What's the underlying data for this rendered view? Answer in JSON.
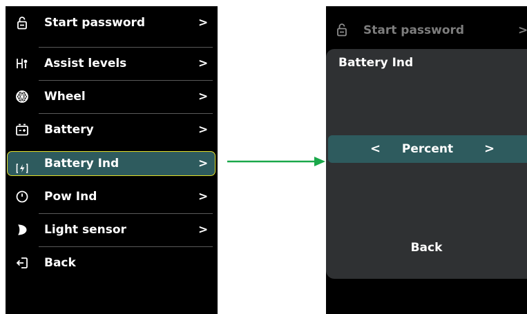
{
  "left_menu": {
    "items": [
      {
        "label": "Start password",
        "icon": "lock-icon",
        "chevron": ">"
      },
      {
        "label": "Assist levels",
        "icon": "assist-levels-icon",
        "chevron": ">"
      },
      {
        "label": "Wheel",
        "icon": "wheel-icon",
        "chevron": ">"
      },
      {
        "label": "Battery",
        "icon": "battery-icon",
        "chevron": ">"
      },
      {
        "label": "Battery Ind",
        "icon": "battery-indicator-icon",
        "chevron": ">",
        "selected": true
      },
      {
        "label": "Pow Ind",
        "icon": "power-indicator-icon",
        "chevron": ">"
      },
      {
        "label": "Light sensor",
        "icon": "light-sensor-icon",
        "chevron": ">"
      },
      {
        "label": "Back",
        "icon": "back-exit-icon"
      }
    ]
  },
  "right_panel": {
    "ghost_item": {
      "label": "Start password",
      "icon": "lock-icon",
      "chevron": ">"
    },
    "dialog": {
      "title": "Battery Ind",
      "prev": "<",
      "value": "Percent",
      "next": ">",
      "back": "Back"
    }
  },
  "colors": {
    "screen_bg": "#000000",
    "highlight": "#2e5b5e",
    "highlight_border": "#e3e02a",
    "dialog_bg": "#2f3133",
    "arrow": "#1aa84a",
    "divider": "#5a5a5a"
  }
}
